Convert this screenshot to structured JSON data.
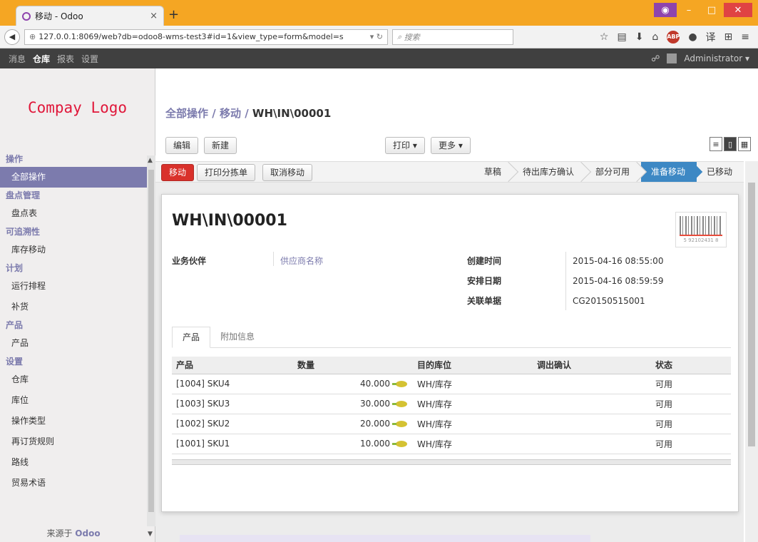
{
  "browser": {
    "tab_title": "移动 - Odoo",
    "tab_close": "×",
    "new_tab": "+",
    "url": "127.0.0.1:8069/web?db=odoo8-wms-test3#id=1&view_type=form&model=s",
    "search_placeholder": "搜索"
  },
  "topmenu": {
    "items": [
      "消息",
      "仓库",
      "报表",
      "设置"
    ],
    "user": "Administrator ▾"
  },
  "sidebar": {
    "logo": "Compay Logo",
    "sections": [
      {
        "title": "操作",
        "items": [
          "全部操作"
        ]
      },
      {
        "title": "盘点管理",
        "items": [
          "盘点表"
        ]
      },
      {
        "title": "可追溯性",
        "items": [
          "库存移动"
        ]
      },
      {
        "title": "计划",
        "items": [
          "运行排程",
          "补货"
        ]
      },
      {
        "title": "产品",
        "items": [
          "产品"
        ]
      },
      {
        "title": "设置",
        "items": [
          "仓库",
          "库位",
          "操作类型",
          "再订货规则",
          "路线",
          "贸易术语"
        ]
      }
    ],
    "powered_prefix": "来源于",
    "powered_brand": "Odoo"
  },
  "breadcrumb": {
    "part1": "全部操作",
    "sep": " / ",
    "part2": "移动",
    "current": "WH\\IN\\00001"
  },
  "controls": {
    "edit": "编辑",
    "create": "新建",
    "print": "打印 ▾",
    "more": "更多 ▾"
  },
  "statusbar": {
    "move": "移动",
    "print_picking": "打印分拣单",
    "cancel_move": "取消移动",
    "stages": [
      "草稿",
      "待出库方确认",
      "部分可用",
      "准备移动",
      "已移动"
    ],
    "current_stage": "准备移动"
  },
  "record": {
    "name": "WH\\IN\\00001",
    "barcode_number": "5 92102431 8",
    "partner_label": "业务伙伴",
    "partner_value": "供应商名称",
    "created_label": "创建时间",
    "created_value": "2015-04-16 08:55:00",
    "scheduled_label": "安排日期",
    "scheduled_value": "2015-04-16 08:59:59",
    "origin_label": "关联单据",
    "origin_value": "CG20150515001"
  },
  "tabs": [
    "产品",
    "附加信息"
  ],
  "lines": {
    "headers": [
      "产品",
      "数量",
      "目的库位",
      "调出确认",
      "状态"
    ],
    "rows": [
      {
        "product": "[1004] SKU4",
        "qty": "40.000",
        "dest": "WH/库存",
        "confirm": "",
        "state": "可用"
      },
      {
        "product": "[1003] SKU3",
        "qty": "30.000",
        "dest": "WH/库存",
        "confirm": "",
        "state": "可用"
      },
      {
        "product": "[1002] SKU2",
        "qty": "20.000",
        "dest": "WH/库存",
        "confirm": "",
        "state": "可用"
      },
      {
        "product": "[1001] SKU1",
        "qty": "10.000",
        "dest": "WH/库存",
        "confirm": "",
        "state": "可用"
      }
    ]
  },
  "colors": {
    "brand": "#7c7bad",
    "current_stage": "#3d88c4",
    "primary_button": "#d9312b",
    "logo": "#e0173a"
  }
}
